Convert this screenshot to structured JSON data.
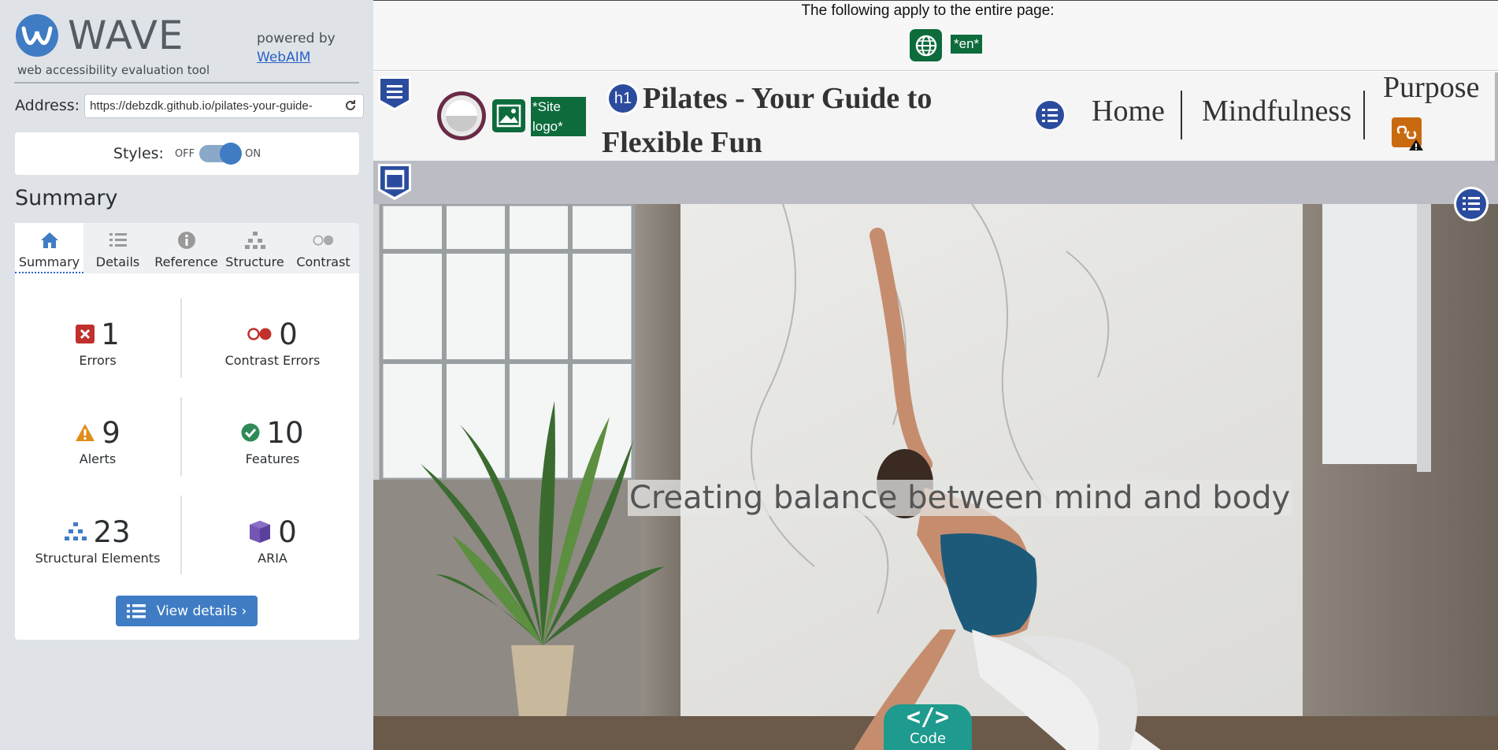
{
  "colors": {
    "wave_blue": "#3f7cc4",
    "sidebar_bg": "#dfe3e8",
    "error_red": "#c0302c",
    "alert_orange": "#e08e1a",
    "feature_green": "#2e8b57",
    "aria_purple": "#5b3f9c",
    "lang_green": "#0d6b3c",
    "code_teal": "#1e9a8e"
  },
  "sidebar": {
    "logo": {
      "word": "WAVE",
      "tagline": "web accessibility evaluation tool"
    },
    "powered": {
      "text": "powered by",
      "link": "WebAIM"
    },
    "address": {
      "label": "Address:",
      "value": "https://debzdk.github.io/pilates-your-guide-",
      "reload_icon": "reload-icon"
    },
    "styles": {
      "label": "Styles:",
      "off": "OFF",
      "on": "ON",
      "state": "on"
    },
    "summary_heading": "Summary",
    "tabs": [
      {
        "label": "Summary",
        "icon": "home-icon",
        "active": true
      },
      {
        "label": "Details",
        "icon": "list-icon",
        "active": false
      },
      {
        "label": "Reference",
        "icon": "info-icon",
        "active": false
      },
      {
        "label": "Structure",
        "icon": "hierarchy-icon",
        "active": false
      },
      {
        "label": "Contrast",
        "icon": "contrast-icon",
        "active": false
      }
    ],
    "stats": {
      "errors": {
        "count": "1",
        "label": "Errors"
      },
      "contrast": {
        "count": "0",
        "label": "Contrast Errors"
      },
      "alerts": {
        "count": "9",
        "label": "Alerts"
      },
      "features": {
        "count": "10",
        "label": "Features"
      },
      "structure": {
        "count": "23",
        "label": "Structural Elements"
      },
      "aria": {
        "count": "0",
        "label": "ARIA"
      }
    },
    "view_details": "View details ›"
  },
  "page": {
    "banner_text": "The following apply to the entire page:",
    "lang_tag": "*en*",
    "logo_alt_tag": "*Site logo*",
    "h1_badge": "h1",
    "site_title": "Pilates - Your Guide to Flexible Fun",
    "nav": [
      "Home",
      "Mindfulness",
      "Purpose"
    ],
    "hero_caption": "Creating balance between mind and body",
    "code_tab": {
      "glyph": "</>",
      "label": "Code"
    }
  }
}
